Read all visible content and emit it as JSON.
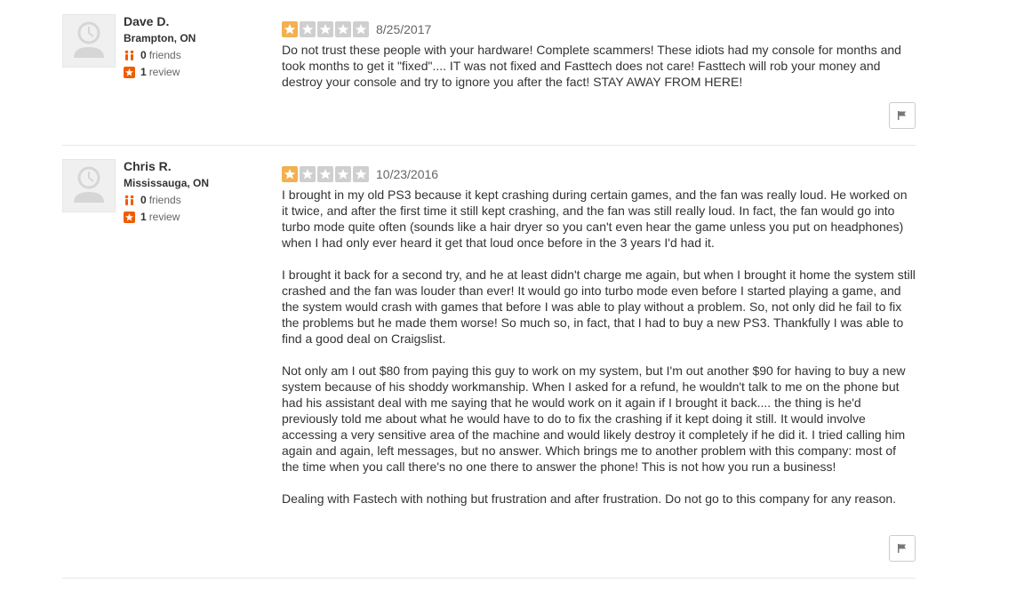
{
  "colors": {
    "star_filled": "#f3b04f",
    "star_empty": "#cfcfcf",
    "accent": "#f15c00"
  },
  "reviews": [
    {
      "user": {
        "name": "Dave D.",
        "location": "Brampton, ON",
        "friends_count": "0",
        "friends_label": "friends",
        "reviews_count": "1",
        "reviews_label": "review"
      },
      "rating": 1,
      "rating_max": 5,
      "date": "8/25/2017",
      "paragraphs": [
        "Do not trust these people with your hardware! Complete scammers! These idiots had my console for months and took months to get it \"fixed\".... IT was not fixed and Fasttech does not care! Fasttech will rob your money and destroy your console and try to ignore you after the fact! STAY AWAY FROM HERE!"
      ]
    },
    {
      "user": {
        "name": "Chris R.",
        "location": "Mississauga, ON",
        "friends_count": "0",
        "friends_label": "friends",
        "reviews_count": "1",
        "reviews_label": "review"
      },
      "rating": 1,
      "rating_max": 5,
      "date": "10/23/2016",
      "paragraphs": [
        "I brought in my old PS3 because it kept crashing during certain games, and the fan was really loud. He worked on it twice, and after the first time it still kept crashing, and the fan was still really loud. In fact, the fan would go into turbo mode quite often (sounds like a hair dryer so you can't even hear the game unless you put on headphones) when I had only ever heard it get that loud once before in the 3 years I'd had it.",
        "I brought it back for a second try, and he at least didn't charge me again, but when I brought it home the system still crashed and the fan was louder than ever! It would go into turbo mode even before I started playing a game, and the system would crash with games that before I was able to play without a problem. So, not only did he fail to fix the problems but he made them worse! So much so, in fact, that I had to buy a new PS3. Thankfully I was able to find a good deal on Craigslist.",
        "Not only am I out $80 from paying this guy to work on my system, but I'm out another $90 for having to buy a new system because of his shoddy workmanship. When I asked for a refund, he wouldn't talk to me on the phone but had his assistant deal with me saying that he would work on it again if I brought it back.... the thing is he'd previously told me about what he would have to do to fix the crashing if it kept doing it still. It would involve accessing a very sensitive area of the machine and would likely destroy it completely if he did it. I tried calling him again and again, left messages, but no answer. Which brings me to another problem with this company: most of the time when you call there's no one there to answer the phone! This is not how you run a business!",
        "Dealing with Fastech with nothing but frustration and after frustration. Do not go to this company for any reason."
      ]
    }
  ]
}
